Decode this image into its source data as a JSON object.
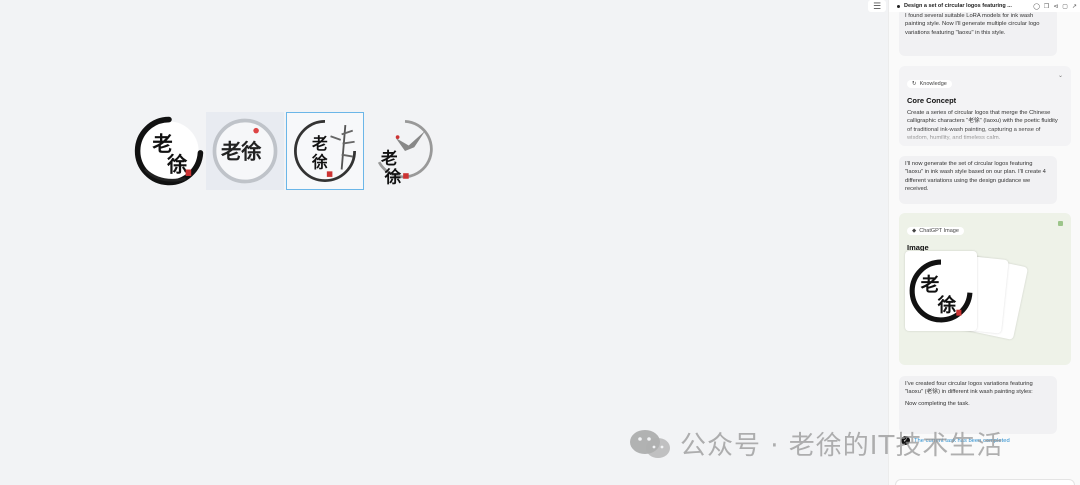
{
  "canvas": {
    "layers_icon": "layers-icon",
    "logos": [
      {
        "chars_top": "老",
        "chars_bottom": "徐",
        "style": "bold-brush-ring"
      },
      {
        "chars": "老徐",
        "style": "grey-wash-circle"
      },
      {
        "chars_top": "老",
        "chars_bottom": "徐",
        "style": "bamboo-ring"
      },
      {
        "chars_top": "老",
        "chars_bottom": "徐",
        "style": "crane-circle"
      }
    ]
  },
  "watermark": {
    "text": "公众号 · 老徐的IT技术生活",
    "icon": "wechat-icon"
  },
  "panel": {
    "title": "Design a set of circular logos featuring ...",
    "topbar_icons": [
      "history-icon",
      "copy-icon",
      "share-icon",
      "duplicate-icon",
      "collapse-icon"
    ],
    "msg1": "I found several suitable LoRA models for ink wash painting style. Now I'll generate multiple circular logo variations featuring \"laoxu\" in this style.",
    "knowledge": {
      "pill": "Knowledge",
      "heading": "Core Concept",
      "body": "Create a series of circular logos that merge the Chinese calligraphic characters “老徐” (laoxu) with the poetic fluidity of traditional ink-wash painting, capturing a sense of wisdom, humility, and timeless calm."
    },
    "msg2": "I'll now generate the set of circular logos featuring \"laoxu\" in ink wash style based on our plan. I'll create 4 different variations using the design guidance we received.",
    "image_card": {
      "pill": "ChatGPT Image",
      "heading": "Image",
      "preview_chars_top": "老",
      "preview_chars_bottom": "徐"
    },
    "msg3_line1": "I've created four circular logos variations featuring \"laoxu\" (老徐) in different ink wash painting styles:",
    "msg3_line2": "Now completing the task.",
    "done_text": "The current task has been completed"
  }
}
